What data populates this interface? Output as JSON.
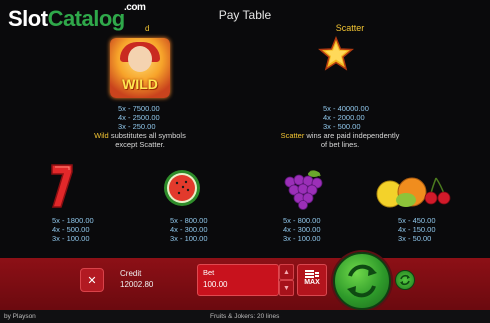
{
  "watermark": {
    "part1": "Slot",
    "part2": "Catalog",
    "suffix": ".com"
  },
  "header": {
    "title": "Pay Table"
  },
  "wild": {
    "label_fragment": "d",
    "symbol_text": "WILD",
    "pays": [
      "5x - 7500.00",
      "4x - 2500.00",
      "3x - 250.00"
    ],
    "desc_keyword": "Wild",
    "desc_rest_line1": " substitutes all symbols",
    "desc_line2": "except Scatter."
  },
  "scatter": {
    "title": "Scatter",
    "pays": [
      "5x - 40000.00",
      "4x - 2000.00",
      "3x - 500.00"
    ],
    "desc_keyword": "Scatter",
    "desc_rest_line1": " wins are paid independently",
    "desc_line2": "of bet lines."
  },
  "symbols": [
    {
      "name": "seven",
      "pays": [
        "5x - 1800.00",
        "4x - 500.00",
        "3x - 100.00"
      ]
    },
    {
      "name": "watermelon",
      "pays": [
        "5x - 800.00",
        "4x - 300.00",
        "3x - 100.00"
      ]
    },
    {
      "name": "grapes",
      "pays": [
        "5x - 800.00",
        "4x - 300.00",
        "3x - 100.00"
      ]
    },
    {
      "name": "citrus-cherry",
      "pays": [
        "5x - 450.00",
        "4x - 150.00",
        "3x - 50.00"
      ]
    }
  ],
  "pagination": {
    "pages": 2,
    "active": 1
  },
  "controls": {
    "close_icon": "close-icon",
    "close_glyph": "✕",
    "credit_label": "Credit",
    "credit_value": "12002.80",
    "bet_label": "Bet",
    "bet_value": "100.00",
    "up_glyph": "▲",
    "down_glyph": "▼",
    "max_label": "MAX",
    "spin_icon": "spin-arrows-icon",
    "autoplay_icon": "autoplay-icon"
  },
  "footer": {
    "brand": "by Playson",
    "brand_suffix": "",
    "game_info": "Fruits & Jokers: 20 lines"
  },
  "colors": {
    "accent_gold": "#f2c433",
    "pays_blue": "#8fc6ea",
    "bar_red": "#8d1016",
    "spin_green": "#2e9a2a"
  }
}
